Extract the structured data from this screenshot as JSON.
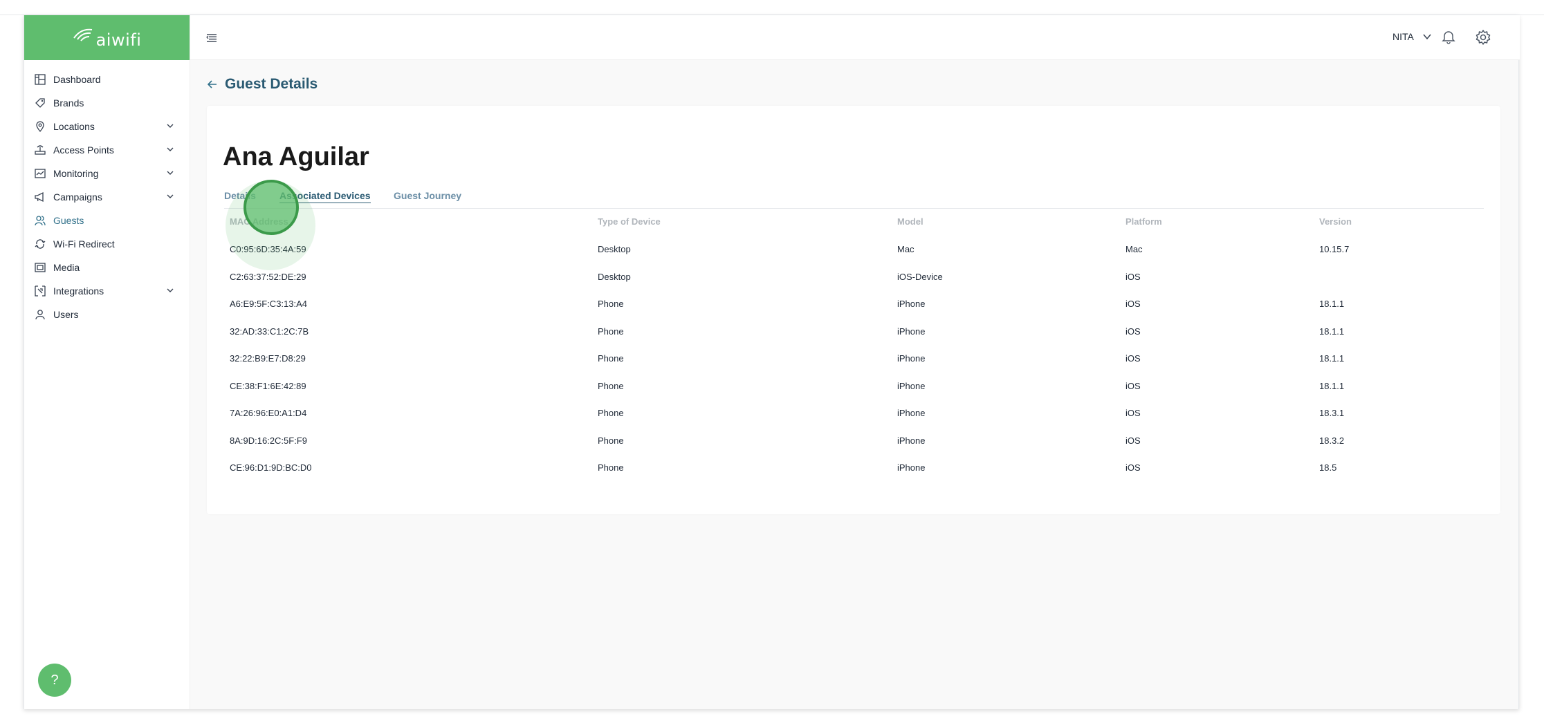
{
  "app": {
    "logo_text": "aiwifi"
  },
  "sidebar": {
    "items": [
      {
        "label": "Dashboard",
        "icon": "dashboard-icon",
        "expandable": false
      },
      {
        "label": "Brands",
        "icon": "tag-icon",
        "expandable": false
      },
      {
        "label": "Locations",
        "icon": "location-pin-icon",
        "expandable": true
      },
      {
        "label": "Access Points",
        "icon": "router-icon",
        "expandable": true
      },
      {
        "label": "Monitoring",
        "icon": "monitor-icon",
        "expandable": true
      },
      {
        "label": "Campaigns",
        "icon": "megaphone-icon",
        "expandable": true
      },
      {
        "label": "Guests",
        "icon": "users-icon",
        "expandable": false,
        "active": true
      },
      {
        "label": "Wi-Fi Redirect",
        "icon": "redirect-icon",
        "expandable": false
      },
      {
        "label": "Media",
        "icon": "media-icon",
        "expandable": false
      },
      {
        "label": "Integrations",
        "icon": "integrations-icon",
        "expandable": true
      },
      {
        "label": "Users",
        "icon": "user-icon",
        "expandable": false
      }
    ],
    "help_label": "?"
  },
  "header": {
    "user_name": "NITA"
  },
  "page": {
    "title": "Guest Details",
    "guest_name": "Ana Aguilar",
    "tabs": [
      {
        "label": "Details"
      },
      {
        "label": "Associated Devices",
        "active": true
      },
      {
        "label": "Guest Journey"
      }
    ]
  },
  "table": {
    "columns": [
      "MAC Address",
      "Type of Device",
      "Model",
      "Platform",
      "Version"
    ],
    "rows": [
      [
        "C0:95:6D:35:4A:59",
        "Desktop",
        "Mac",
        "Mac",
        "10.15.7"
      ],
      [
        "C2:63:37:52:DE:29",
        "Desktop",
        "iOS-Device",
        "iOS",
        ""
      ],
      [
        "A6:E9:5F:C3:13:A4",
        "Phone",
        "iPhone",
        "iOS",
        "18.1.1"
      ],
      [
        "32:AD:33:C1:2C:7B",
        "Phone",
        "iPhone",
        "iOS",
        "18.1.1"
      ],
      [
        "32:22:B9:E7:D8:29",
        "Phone",
        "iPhone",
        "iOS",
        "18.1.1"
      ],
      [
        "CE:38:F1:6E:42:89",
        "Phone",
        "iPhone",
        "iOS",
        "18.1.1"
      ],
      [
        "7A:26:96:E0:A1:D4",
        "Phone",
        "iPhone",
        "iOS",
        "18.3.1"
      ],
      [
        "8A:9D:16:2C:5F:F9",
        "Phone",
        "iPhone",
        "iOS",
        "18.3.2"
      ],
      [
        "CE:96:D1:9D:BC:D0",
        "Phone",
        "iPhone",
        "iOS",
        "18.5"
      ]
    ]
  },
  "colors": {
    "brand_green": "#5fbd6e",
    "accent_blue": "#2a5a72"
  }
}
